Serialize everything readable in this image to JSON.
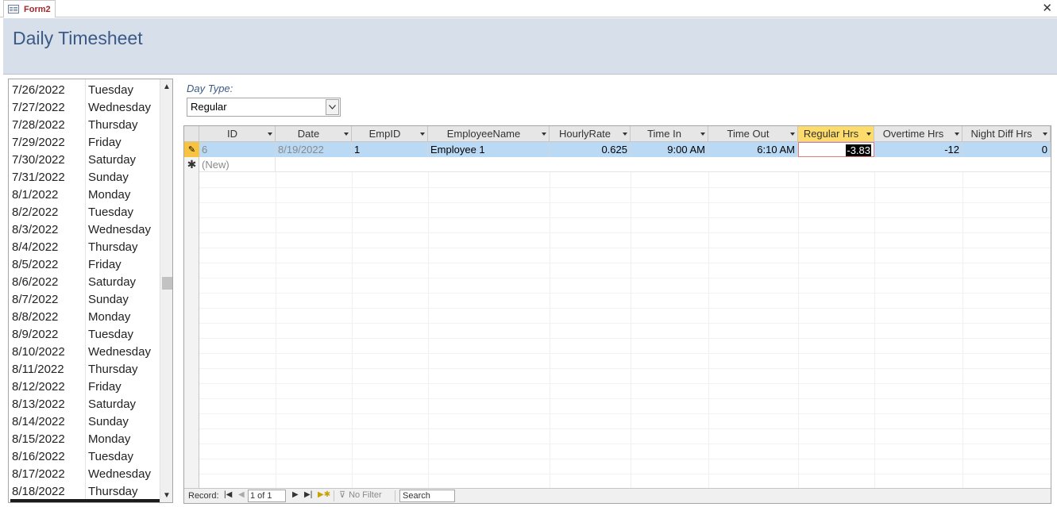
{
  "tab": {
    "title": "Form2"
  },
  "header": {
    "title": "Daily Timesheet"
  },
  "date_list": [
    {
      "date": "7/26/2022",
      "weekday": "Tuesday"
    },
    {
      "date": "7/27/2022",
      "weekday": "Wednesday"
    },
    {
      "date": "7/28/2022",
      "weekday": "Thursday"
    },
    {
      "date": "7/29/2022",
      "weekday": "Friday"
    },
    {
      "date": "7/30/2022",
      "weekday": "Saturday"
    },
    {
      "date": "7/31/2022",
      "weekday": "Sunday"
    },
    {
      "date": "8/1/2022",
      "weekday": "Monday"
    },
    {
      "date": "8/2/2022",
      "weekday": "Tuesday"
    },
    {
      "date": "8/3/2022",
      "weekday": "Wednesday"
    },
    {
      "date": "8/4/2022",
      "weekday": "Thursday"
    },
    {
      "date": "8/5/2022",
      "weekday": "Friday"
    },
    {
      "date": "8/6/2022",
      "weekday": "Saturday"
    },
    {
      "date": "8/7/2022",
      "weekday": "Sunday"
    },
    {
      "date": "8/8/2022",
      "weekday": "Monday"
    },
    {
      "date": "8/9/2022",
      "weekday": "Tuesday"
    },
    {
      "date": "8/10/2022",
      "weekday": "Wednesday"
    },
    {
      "date": "8/11/2022",
      "weekday": "Thursday"
    },
    {
      "date": "8/12/2022",
      "weekday": "Friday"
    },
    {
      "date": "8/13/2022",
      "weekday": "Saturday"
    },
    {
      "date": "8/14/2022",
      "weekday": "Sunday"
    },
    {
      "date": "8/15/2022",
      "weekday": "Monday"
    },
    {
      "date": "8/16/2022",
      "weekday": "Tuesday"
    },
    {
      "date": "8/17/2022",
      "weekday": "Wednesday"
    },
    {
      "date": "8/18/2022",
      "weekday": "Thursday"
    }
  ],
  "day_type": {
    "label": "Day Type:",
    "value": "Regular"
  },
  "datasheet": {
    "columns": [
      "ID",
      "Date",
      "EmpID",
      "EmployeeName",
      "HourlyRate",
      "Time In",
      "Time Out",
      "Regular Hrs",
      "Overtime Hrs",
      "Night Diff Hrs"
    ],
    "selected_column": "Regular Hrs",
    "rows": [
      [
        "6",
        "8/19/2022",
        "1",
        "Employee 1",
        "0.625",
        "9:00 AM",
        "6:10 AM",
        "-3.83",
        "-12",
        "0"
      ]
    ],
    "new_row_label": "(New)"
  },
  "navigation": {
    "record_label": "Record:",
    "record_position": "1 of 1",
    "filter_label": "No Filter",
    "search_label": "Search"
  },
  "colors": {
    "header_bg": "#d6dfea",
    "title_color": "#3c5a86",
    "selected_header": "#fddc6b",
    "selected_row": "#b9d9f5",
    "tab_title": "#a4262c"
  },
  "icons": {
    "tab": "form-icon",
    "close": "close-icon",
    "edit_row": "pencil-icon",
    "new_row": "asterisk-icon"
  }
}
